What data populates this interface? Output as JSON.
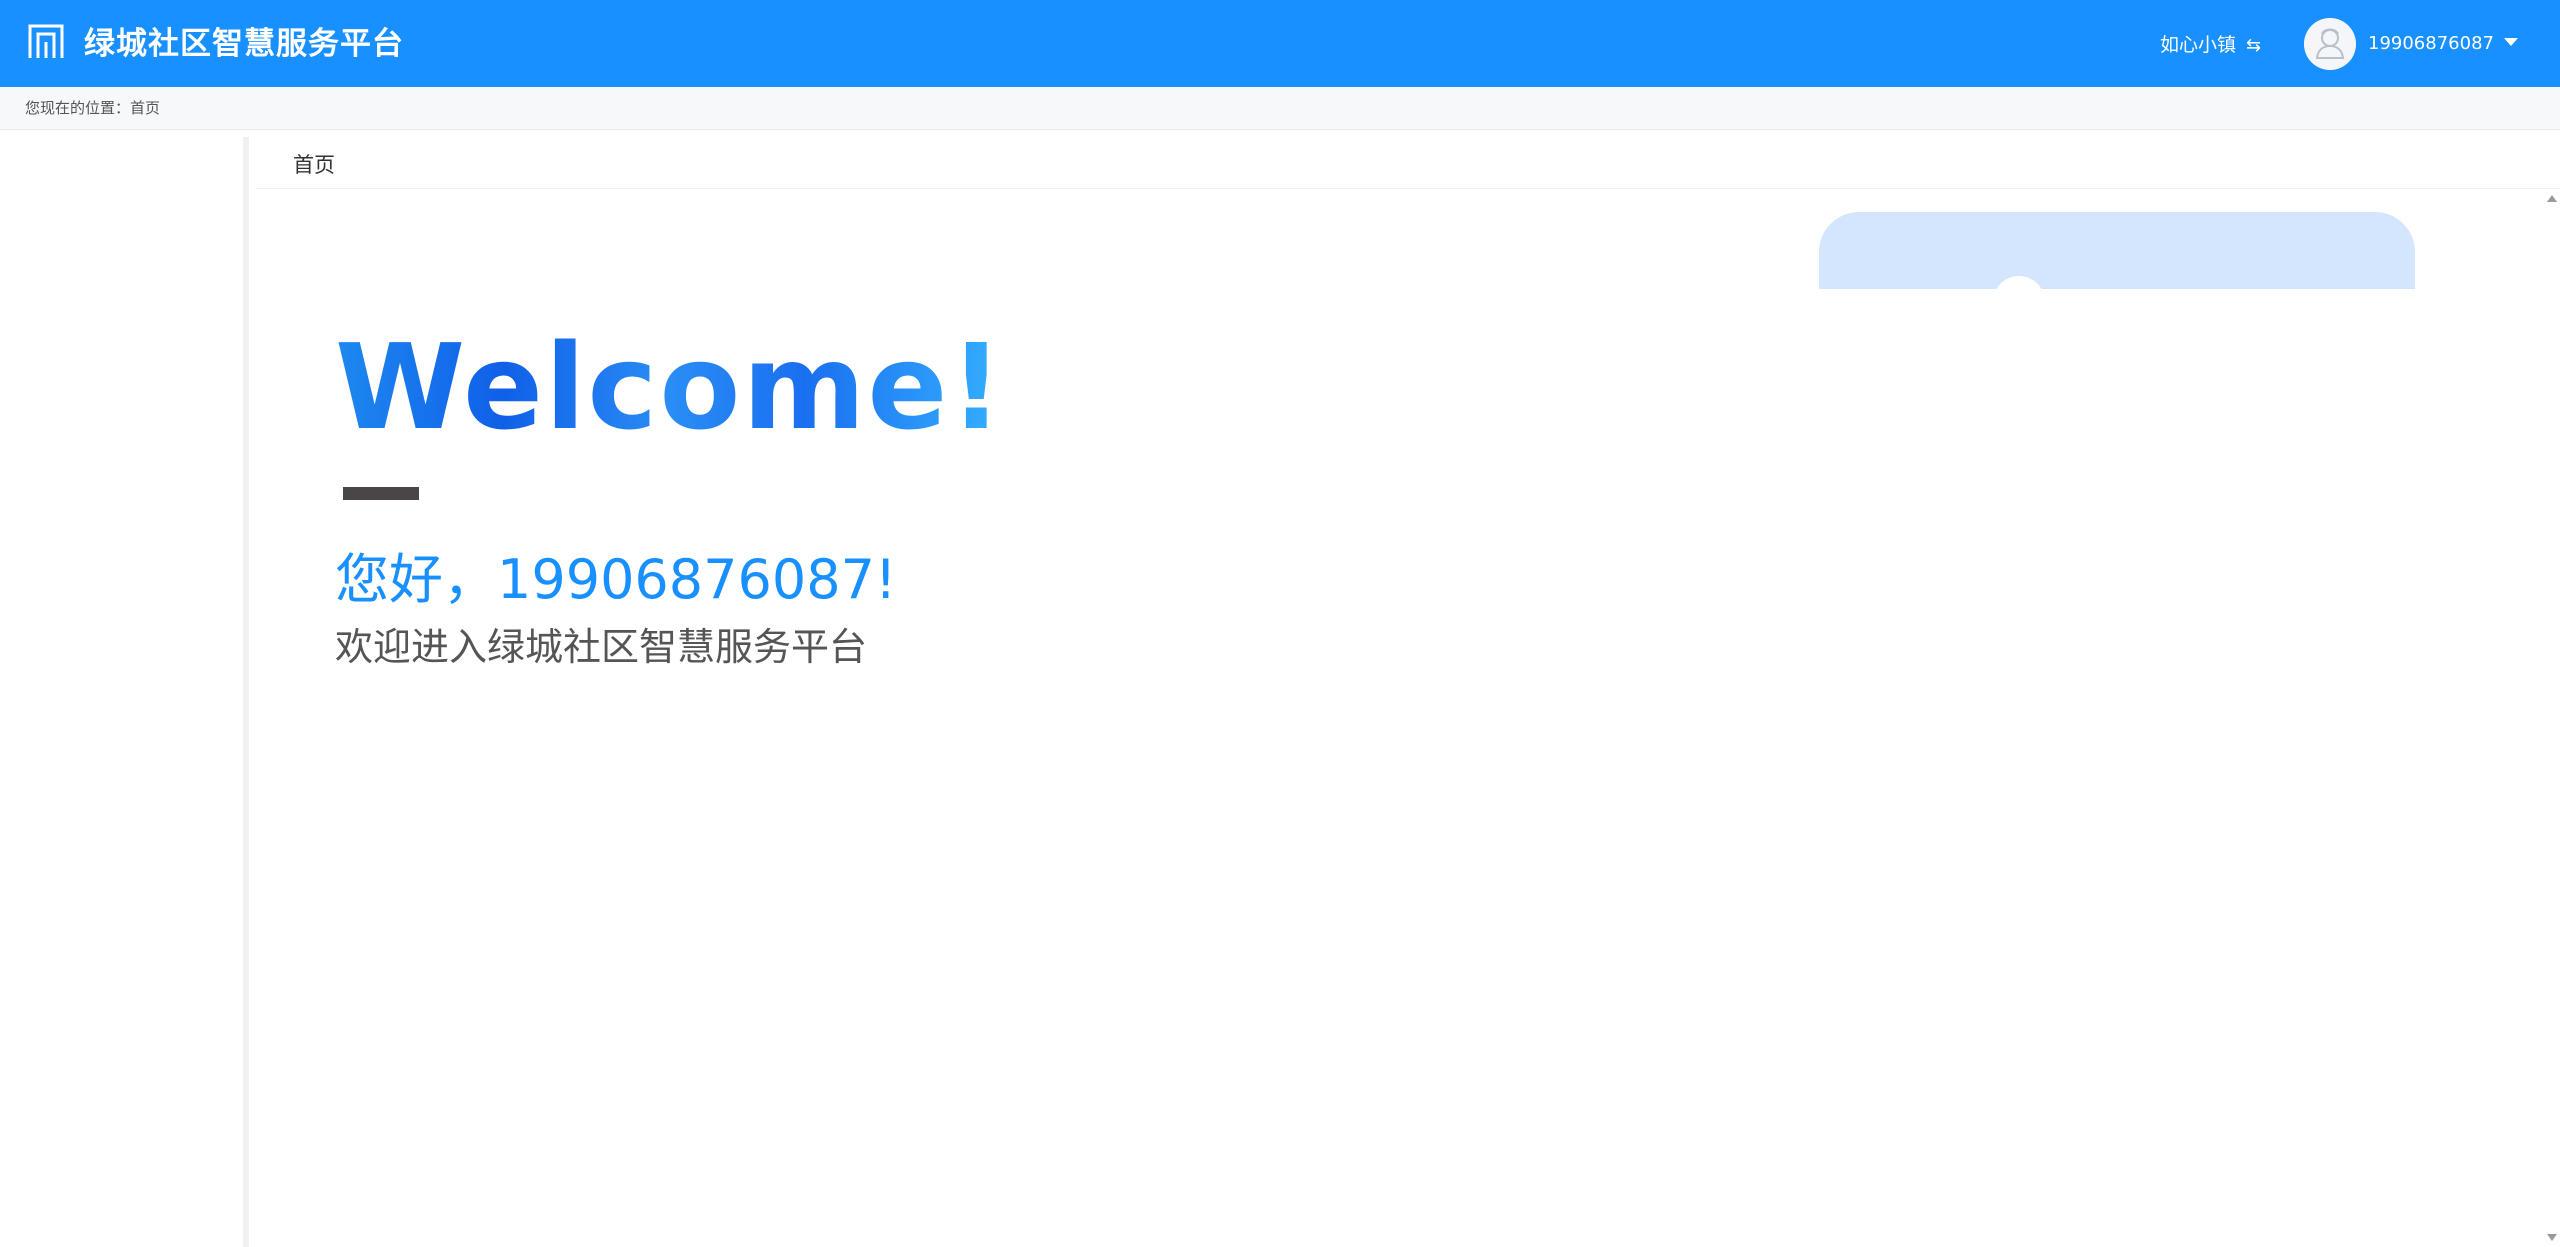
{
  "header": {
    "app_title": "绿城社区智慧服务平台",
    "town_name": "如心小镇",
    "swap_icon": "⇆",
    "username": "19906876087",
    "color": "#1890ff"
  },
  "breadcrumb": {
    "label": "您现在的位置：",
    "current": "首页"
  },
  "tabs": [
    {
      "label": "首页"
    }
  ],
  "main": {
    "welcome": "Welcome!",
    "greeting": "您好，19906876087!",
    "subtitle": "欢迎进入绿城社区智慧服务平台"
  }
}
